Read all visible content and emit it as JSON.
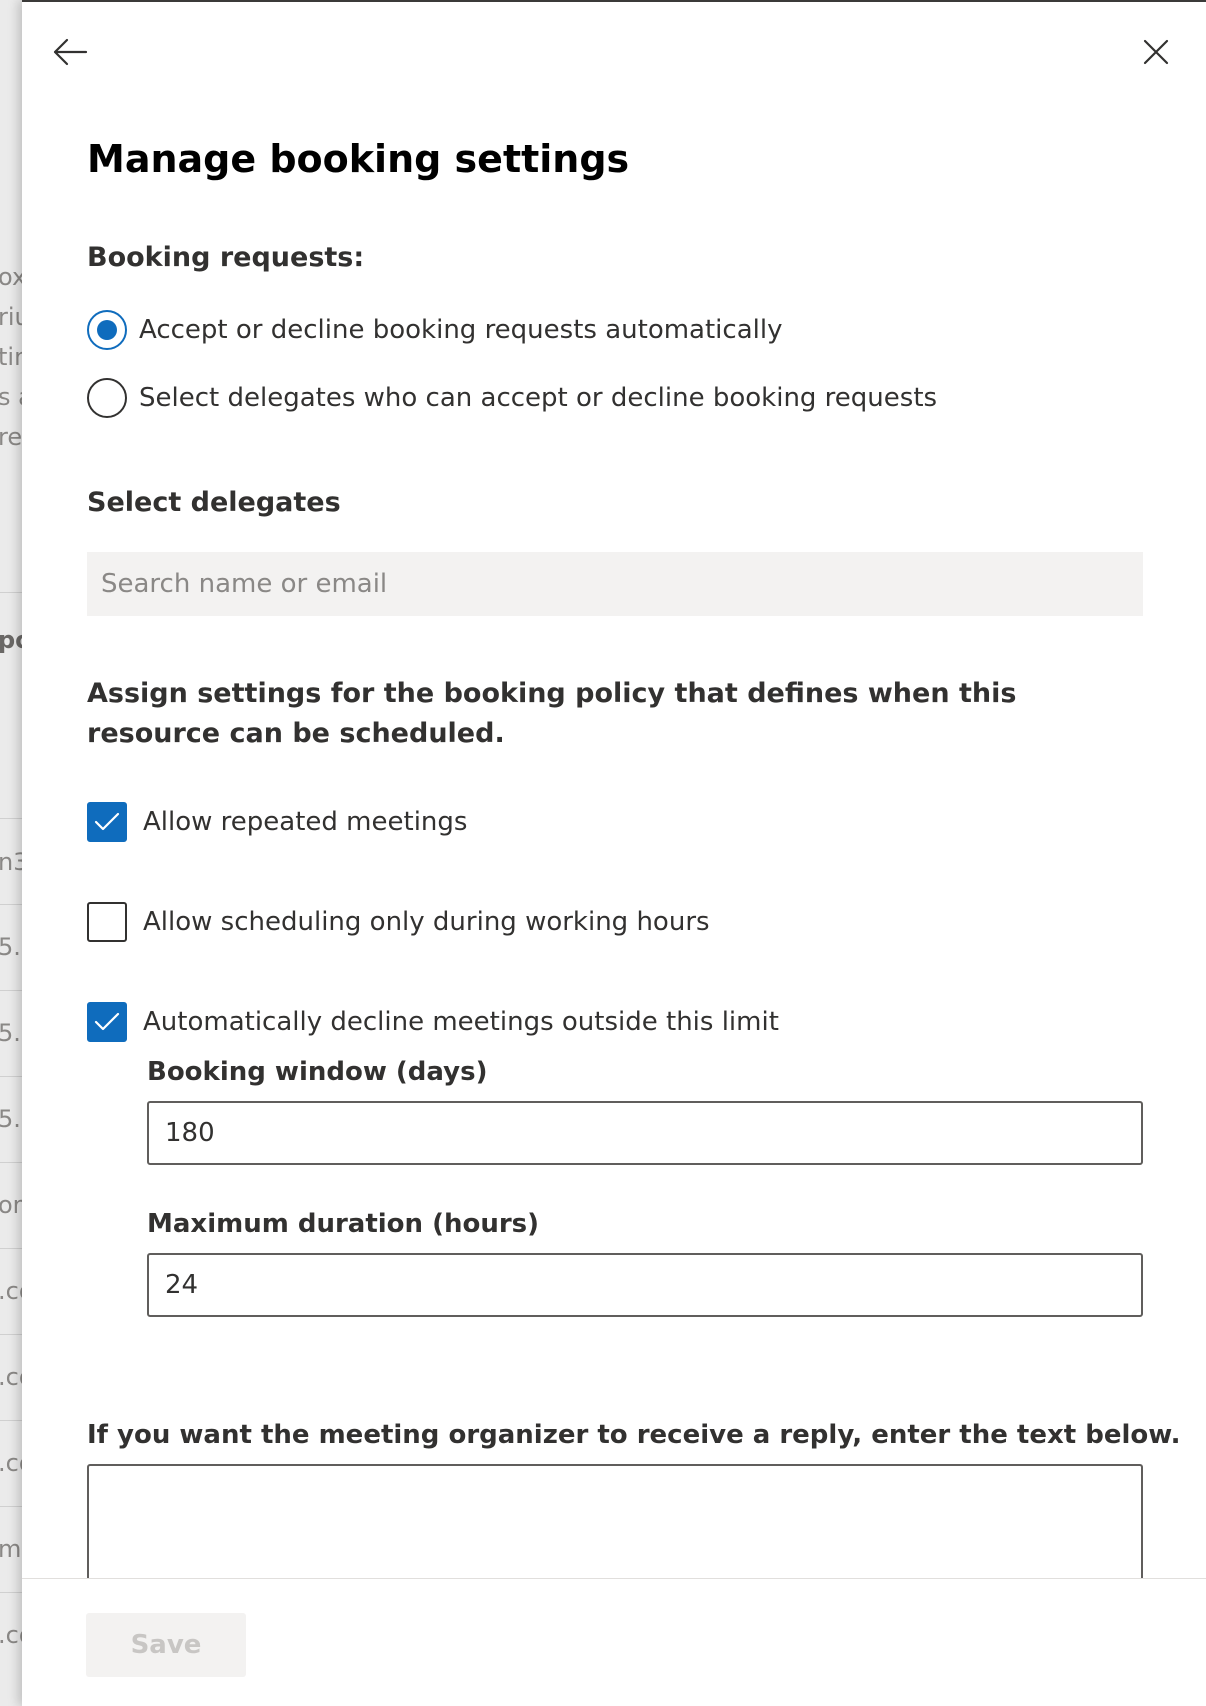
{
  "background": {
    "fragments": [
      "ox",
      "riu",
      "tin",
      "s a",
      "re",
      "po",
      "n3",
      "5.",
      "5.",
      "5.",
      "om",
      ".co",
      ".co",
      ".co",
      "m",
      ".co"
    ]
  },
  "header": {
    "back_icon": "arrow-left-icon",
    "close_icon": "close-icon",
    "title": "Manage booking settings"
  },
  "booking_requests": {
    "label": "Booking requests:",
    "options": [
      {
        "label": "Accept or decline booking requests automatically",
        "checked": true
      },
      {
        "label": "Select delegates who can accept or decline booking requests",
        "checked": false
      }
    ]
  },
  "delegates": {
    "label": "Select delegates",
    "search_placeholder": "Search name or email"
  },
  "policy": {
    "heading": "Assign settings for the booking policy that defines when this resource can be scheduled.",
    "options": [
      {
        "label": "Allow repeated meetings",
        "checked": true
      },
      {
        "label": "Allow scheduling only during working hours",
        "checked": false
      },
      {
        "label": "Automatically decline meetings outside this limit",
        "checked": true
      }
    ],
    "booking_window_label": "Booking window (days)",
    "booking_window_value": "180",
    "max_duration_label": "Maximum duration (hours)",
    "max_duration_value": "24"
  },
  "reply": {
    "label": "If you want the meeting organizer to receive a reply, enter the text below.",
    "value": ""
  },
  "footer": {
    "save_label": "Save",
    "save_disabled": true
  },
  "colors": {
    "accent": "#0f6cbd",
    "text": "#323130",
    "disabled_bg": "#f3f2f1",
    "disabled_text": "#c8c6c4"
  }
}
